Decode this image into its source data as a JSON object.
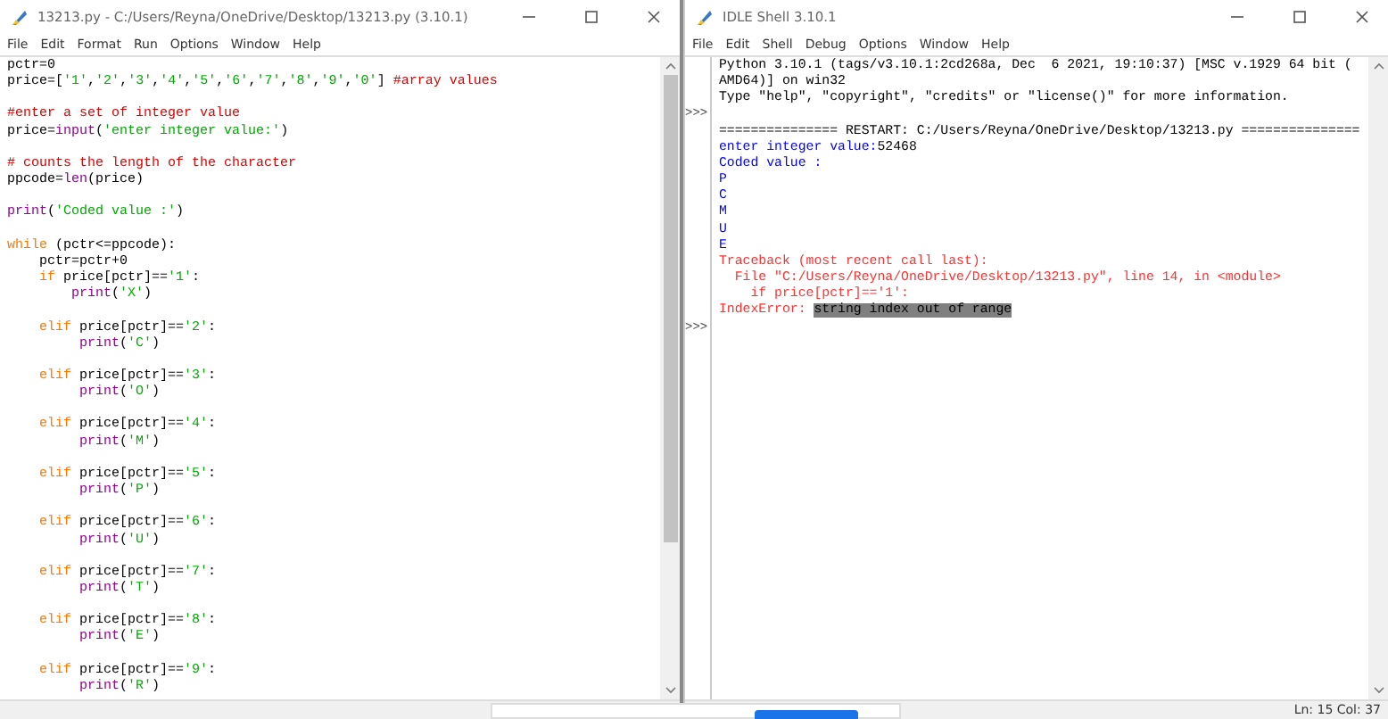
{
  "editor_window": {
    "title": "13213.py - C:/Users/Reyna/OneDrive/Desktop/13213.py (3.10.1)",
    "menu": [
      "File",
      "Edit",
      "Format",
      "Run",
      "Options",
      "Window",
      "Help"
    ],
    "lines": [
      {
        "space_before": false,
        "tokens": [
          {
            "kind": "default",
            "text": "pctr=0"
          }
        ]
      },
      {
        "space_before": false,
        "tokens": [
          {
            "kind": "default",
            "text": "price=["
          },
          {
            "kind": "string",
            "text": "'1'"
          },
          {
            "kind": "default",
            "text": ","
          },
          {
            "kind": "string",
            "text": "'2'"
          },
          {
            "kind": "default",
            "text": ","
          },
          {
            "kind": "string",
            "text": "'3'"
          },
          {
            "kind": "default",
            "text": ","
          },
          {
            "kind": "string",
            "text": "'4'"
          },
          {
            "kind": "default",
            "text": ","
          },
          {
            "kind": "string",
            "text": "'5'"
          },
          {
            "kind": "default",
            "text": ","
          },
          {
            "kind": "string",
            "text": "'6'"
          },
          {
            "kind": "default",
            "text": ","
          },
          {
            "kind": "string",
            "text": "'7'"
          },
          {
            "kind": "default",
            "text": ","
          },
          {
            "kind": "string",
            "text": "'8'"
          },
          {
            "kind": "default",
            "text": ","
          },
          {
            "kind": "string",
            "text": "'9'"
          },
          {
            "kind": "default",
            "text": ","
          },
          {
            "kind": "string",
            "text": "'0'"
          },
          {
            "kind": "default",
            "text": "] "
          },
          {
            "kind": "comment",
            "text": "#array values"
          }
        ]
      },
      {
        "space_before": true,
        "tokens": [
          {
            "kind": "comment",
            "text": "#enter a set of integer value"
          }
        ]
      },
      {
        "space_before": false,
        "tokens": [
          {
            "kind": "default",
            "text": "price="
          },
          {
            "kind": "builtin",
            "text": "input"
          },
          {
            "kind": "default",
            "text": "("
          },
          {
            "kind": "string",
            "text": "'enter integer value:'"
          },
          {
            "kind": "default",
            "text": ")"
          }
        ]
      },
      {
        "space_before": true,
        "tokens": [
          {
            "kind": "comment",
            "text": "# counts the length of the character"
          }
        ]
      },
      {
        "space_before": false,
        "tokens": [
          {
            "kind": "default",
            "text": "ppcode="
          },
          {
            "kind": "builtin",
            "text": "len"
          },
          {
            "kind": "default",
            "text": "(price)"
          }
        ]
      },
      {
        "space_before": true,
        "tokens": [
          {
            "kind": "builtin",
            "text": "print"
          },
          {
            "kind": "default",
            "text": "("
          },
          {
            "kind": "string",
            "text": "'Coded value :'"
          },
          {
            "kind": "default",
            "text": ")"
          }
        ]
      },
      {
        "space_before": true,
        "tokens": [
          {
            "kind": "keyword",
            "text": "while"
          },
          {
            "kind": "default",
            "text": " (pctr<=ppcode):"
          }
        ]
      },
      {
        "space_before": false,
        "tokens": [
          {
            "kind": "default",
            "text": "    pctr=pctr+0"
          }
        ]
      },
      {
        "space_before": false,
        "tokens": [
          {
            "kind": "keyword",
            "text": "    if"
          },
          {
            "kind": "default",
            "text": " price[pctr]=="
          },
          {
            "kind": "string",
            "text": "'1'"
          },
          {
            "kind": "default",
            "text": ":"
          }
        ]
      },
      {
        "space_before": false,
        "tokens": [
          {
            "kind": "builtin",
            "text": "        print"
          },
          {
            "kind": "default",
            "text": "("
          },
          {
            "kind": "string",
            "text": "'X'"
          },
          {
            "kind": "default",
            "text": ")"
          }
        ]
      },
      {
        "space_before": true,
        "tokens": [
          {
            "kind": "keyword",
            "text": "    elif"
          },
          {
            "kind": "default",
            "text": " price[pctr]=="
          },
          {
            "kind": "string",
            "text": "'2'"
          },
          {
            "kind": "default",
            "text": ":"
          }
        ]
      },
      {
        "space_before": false,
        "tokens": [
          {
            "kind": "builtin",
            "text": "         print"
          },
          {
            "kind": "default",
            "text": "("
          },
          {
            "kind": "string",
            "text": "'C'"
          },
          {
            "kind": "default",
            "text": ")"
          }
        ]
      },
      {
        "space_before": true,
        "tokens": [
          {
            "kind": "keyword",
            "text": "    elif"
          },
          {
            "kind": "default",
            "text": " price[pctr]=="
          },
          {
            "kind": "string",
            "text": "'3'"
          },
          {
            "kind": "default",
            "text": ":"
          }
        ]
      },
      {
        "space_before": false,
        "tokens": [
          {
            "kind": "builtin",
            "text": "         print"
          },
          {
            "kind": "default",
            "text": "("
          },
          {
            "kind": "string",
            "text": "'O'"
          },
          {
            "kind": "default",
            "text": ")"
          }
        ]
      },
      {
        "space_before": true,
        "tokens": [
          {
            "kind": "keyword",
            "text": "    elif"
          },
          {
            "kind": "default",
            "text": " price[pctr]=="
          },
          {
            "kind": "string",
            "text": "'4'"
          },
          {
            "kind": "default",
            "text": ":"
          }
        ]
      },
      {
        "space_before": false,
        "tokens": [
          {
            "kind": "builtin",
            "text": "         print"
          },
          {
            "kind": "default",
            "text": "("
          },
          {
            "kind": "string",
            "text": "'M'"
          },
          {
            "kind": "default",
            "text": ")"
          }
        ]
      },
      {
        "space_before": true,
        "tokens": [
          {
            "kind": "keyword",
            "text": "    elif"
          },
          {
            "kind": "default",
            "text": " price[pctr]=="
          },
          {
            "kind": "string",
            "text": "'5'"
          },
          {
            "kind": "default",
            "text": ":"
          }
        ]
      },
      {
        "space_before": false,
        "tokens": [
          {
            "kind": "builtin",
            "text": "         print"
          },
          {
            "kind": "default",
            "text": "("
          },
          {
            "kind": "string",
            "text": "'P'"
          },
          {
            "kind": "default",
            "text": ")"
          }
        ]
      },
      {
        "space_before": true,
        "tokens": [
          {
            "kind": "keyword",
            "text": "    elif"
          },
          {
            "kind": "default",
            "text": " price[pctr]=="
          },
          {
            "kind": "string",
            "text": "'6'"
          },
          {
            "kind": "default",
            "text": ":"
          }
        ]
      },
      {
        "space_before": false,
        "tokens": [
          {
            "kind": "builtin",
            "text": "         print"
          },
          {
            "kind": "default",
            "text": "("
          },
          {
            "kind": "string",
            "text": "'U'"
          },
          {
            "kind": "default",
            "text": ")"
          }
        ]
      },
      {
        "space_before": true,
        "tokens": [
          {
            "kind": "keyword",
            "text": "    elif"
          },
          {
            "kind": "default",
            "text": " price[pctr]=="
          },
          {
            "kind": "string",
            "text": "'7'"
          },
          {
            "kind": "default",
            "text": ":"
          }
        ]
      },
      {
        "space_before": false,
        "tokens": [
          {
            "kind": "builtin",
            "text": "         print"
          },
          {
            "kind": "default",
            "text": "("
          },
          {
            "kind": "string",
            "text": "'T'"
          },
          {
            "kind": "default",
            "text": ")"
          }
        ]
      },
      {
        "space_before": true,
        "tokens": [
          {
            "kind": "keyword",
            "text": "    elif"
          },
          {
            "kind": "default",
            "text": " price[pctr]=="
          },
          {
            "kind": "string",
            "text": "'8'"
          },
          {
            "kind": "default",
            "text": ":"
          }
        ]
      },
      {
        "space_before": false,
        "tokens": [
          {
            "kind": "builtin",
            "text": "         print"
          },
          {
            "kind": "default",
            "text": "("
          },
          {
            "kind": "string",
            "text": "'E'"
          },
          {
            "kind": "default",
            "text": ")"
          }
        ]
      },
      {
        "space_before": true,
        "tokens": [
          {
            "kind": "keyword",
            "text": "    elif"
          },
          {
            "kind": "default",
            "text": " price[pctr]=="
          },
          {
            "kind": "string",
            "text": "'9'"
          },
          {
            "kind": "default",
            "text": ":"
          }
        ]
      },
      {
        "space_before": false,
        "tokens": [
          {
            "kind": "builtin",
            "text": "         print"
          },
          {
            "kind": "default",
            "text": "("
          },
          {
            "kind": "string",
            "text": "'R'"
          },
          {
            "kind": "default",
            "text": ")"
          }
        ]
      }
    ]
  },
  "shell_window": {
    "title": "IDLE Shell 3.10.1",
    "menu": [
      "File",
      "Edit",
      "Shell",
      "Debug",
      "Options",
      "Window",
      "Help"
    ],
    "lines": [
      {
        "tokens": [
          {
            "kind": "default",
            "selected": false,
            "text": "Python 3.10.1 (tags/v3.10.1:2cd268a, Dec  6 2021, 19:10:37) [MSC v.1929 64 bit ("
          }
        ]
      },
      {
        "tokens": [
          {
            "kind": "default",
            "selected": false,
            "text": "AMD64)] on win32"
          }
        ]
      },
      {
        "tokens": [
          {
            "kind": "default",
            "selected": false,
            "text": "Type \"help\", \"copyright\", \"credits\" or \"license()\" for more information."
          }
        ]
      },
      {
        "prompt": ">>>"
      },
      {
        "tokens": [
          {
            "kind": "default",
            "selected": false,
            "text": "=============== RESTART: C:/Users/Reyna/OneDrive/Desktop/13213.py ==============="
          }
        ]
      },
      {
        "tokens": [
          {
            "kind": "stdout",
            "selected": false,
            "text": "enter integer value:"
          },
          {
            "kind": "default",
            "selected": false,
            "text": "52468"
          }
        ]
      },
      {
        "tokens": [
          {
            "kind": "stdout",
            "selected": false,
            "text": "Coded value :"
          }
        ]
      },
      {
        "tokens": [
          {
            "kind": "stdout",
            "selected": false,
            "text": "P"
          }
        ]
      },
      {
        "tokens": [
          {
            "kind": "stdout",
            "selected": false,
            "text": "C"
          }
        ]
      },
      {
        "tokens": [
          {
            "kind": "stdout",
            "selected": false,
            "text": "M"
          }
        ]
      },
      {
        "tokens": [
          {
            "kind": "stdout",
            "selected": false,
            "text": "U"
          }
        ]
      },
      {
        "tokens": [
          {
            "kind": "stdout",
            "selected": false,
            "text": "E"
          }
        ]
      },
      {
        "tokens": [
          {
            "kind": "stderr",
            "selected": false,
            "text": "Traceback (most recent call last):"
          }
        ]
      },
      {
        "tokens": [
          {
            "kind": "stderr",
            "selected": false,
            "text": "  File \"C:/Users/Reyna/OneDrive/Desktop/13213.py\", line 14, in <module>"
          }
        ]
      },
      {
        "tokens": [
          {
            "kind": "stderr",
            "selected": false,
            "text": "    if price[pctr]=='1':"
          }
        ]
      },
      {
        "tokens": [
          {
            "kind": "stderr",
            "selected": false,
            "text": "IndexError: "
          },
          {
            "kind": "stderr",
            "selected": true,
            "text": "string index out of range"
          }
        ]
      },
      {
        "prompt": ">>>"
      }
    ],
    "status": "Ln: 15  Col: 37"
  }
}
